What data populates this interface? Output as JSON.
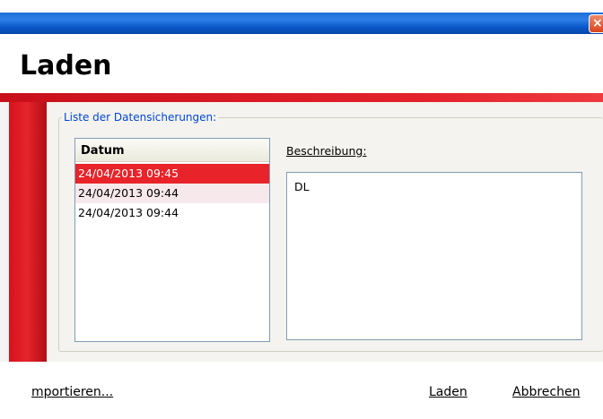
{
  "window": {
    "close_glyph": "×"
  },
  "header": {
    "title": "Laden"
  },
  "group": {
    "legend": "Liste der Datensicherungen:"
  },
  "list": {
    "column_header": "Datum",
    "rows": [
      {
        "date": "24/04/2013 09:45",
        "state": "selected"
      },
      {
        "date": "24/04/2013 09:44",
        "state": "hover"
      },
      {
        "date": "24/04/2013 09:44",
        "state": "normal"
      }
    ]
  },
  "description": {
    "label": "Beschreibung:",
    "value": "DL"
  },
  "footer": {
    "import_label": "mportieren...",
    "load_label": "Laden",
    "cancel_label": "Abbrechen"
  },
  "colors": {
    "accent_red": "#e3222b",
    "selection": "#e8242a",
    "titlebar_blue": "#0a58c9",
    "legend_blue": "#0046d5"
  }
}
